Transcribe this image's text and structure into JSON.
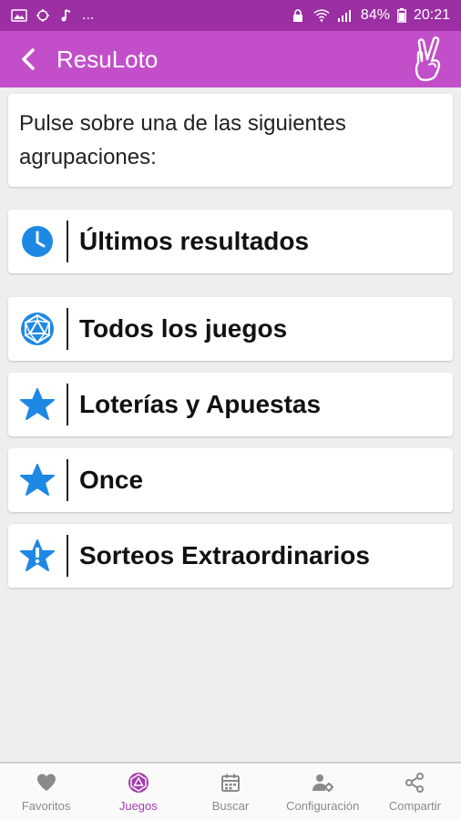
{
  "status_bar": {
    "left_icons": [
      "image-icon",
      "sync-icon",
      "music-note-icon",
      "more-dots-icon"
    ],
    "more": "...",
    "right_icons": [
      "lock-icon",
      "wifi-icon",
      "signal-icon",
      "battery-icon"
    ],
    "battery": "84%",
    "time": "20:21"
  },
  "app_bar": {
    "title": "ResuLoto",
    "back_icon": "arrow-back-icon",
    "logo_icon": "crossed-fingers-icon"
  },
  "intro": {
    "text": "Pulse sobre una de las siguientes agrupaciones:"
  },
  "groups": [
    {
      "label": "Últimos resultados",
      "icon": "clock-icon"
    },
    {
      "label": "Todos los juegos",
      "icon": "dice-icon"
    },
    {
      "label": "Loterías y Apuestas",
      "icon": "star-icon"
    },
    {
      "label": "Once",
      "icon": "star-icon"
    },
    {
      "label": "Sorteos Extraordinarios",
      "icon": "star-exclamation-icon"
    }
  ],
  "bottom_nav": [
    {
      "label": "Favoritos",
      "icon": "heart-icon",
      "active": false
    },
    {
      "label": "Juegos",
      "icon": "dice-icon",
      "active": true
    },
    {
      "label": "Buscar",
      "icon": "calendar-icon",
      "active": false
    },
    {
      "label": "Configuración",
      "icon": "user-settings-icon",
      "active": false
    },
    {
      "label": "Compartir",
      "icon": "share-icon",
      "active": false
    }
  ],
  "colors": {
    "status_bar": "#9c2fa3",
    "app_bar": "#c24fc9",
    "icon_blue": "#1e88e5",
    "nav_active": "#a43cb0",
    "nav_inactive": "#8a8a8a",
    "background": "#eeeeee"
  }
}
